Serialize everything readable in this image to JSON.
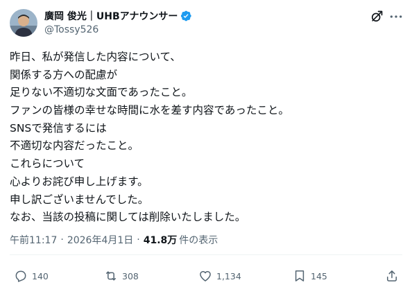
{
  "author": {
    "display_name": "廣岡 俊光｜UHBアナウンサー",
    "handle": "@Tossy526",
    "verified": true,
    "avatar_icon": "avatar-photo"
  },
  "top_icons": [
    "grok-icon",
    "more-icon"
  ],
  "post": {
    "lines": [
      "昨日、私が発信した内容について、",
      "関係する方への配慮が",
      "足りない不適切な文面であったこと。",
      "ファンの皆様の幸せな時間に水を差す内容であったこと。",
      "SNSで発信するには",
      "不適切な内容だったこと。",
      "これらについて",
      "心よりお詫び申し上げます。",
      "申し訳ございませんでした。",
      "なお、当該の投稿に関しては削除いたしました。"
    ]
  },
  "meta": {
    "time": "午前11:17",
    "date": "2026年4月1日",
    "separator": "·",
    "views_count": "41.8万",
    "views_label": "件の表示"
  },
  "actions": {
    "replies": "140",
    "reposts": "308",
    "likes": "1,134",
    "bookmarks": "145"
  },
  "colors": {
    "verified": "#1d9bf0",
    "secondary_text": "#536471",
    "primary_text": "#0f1419"
  }
}
